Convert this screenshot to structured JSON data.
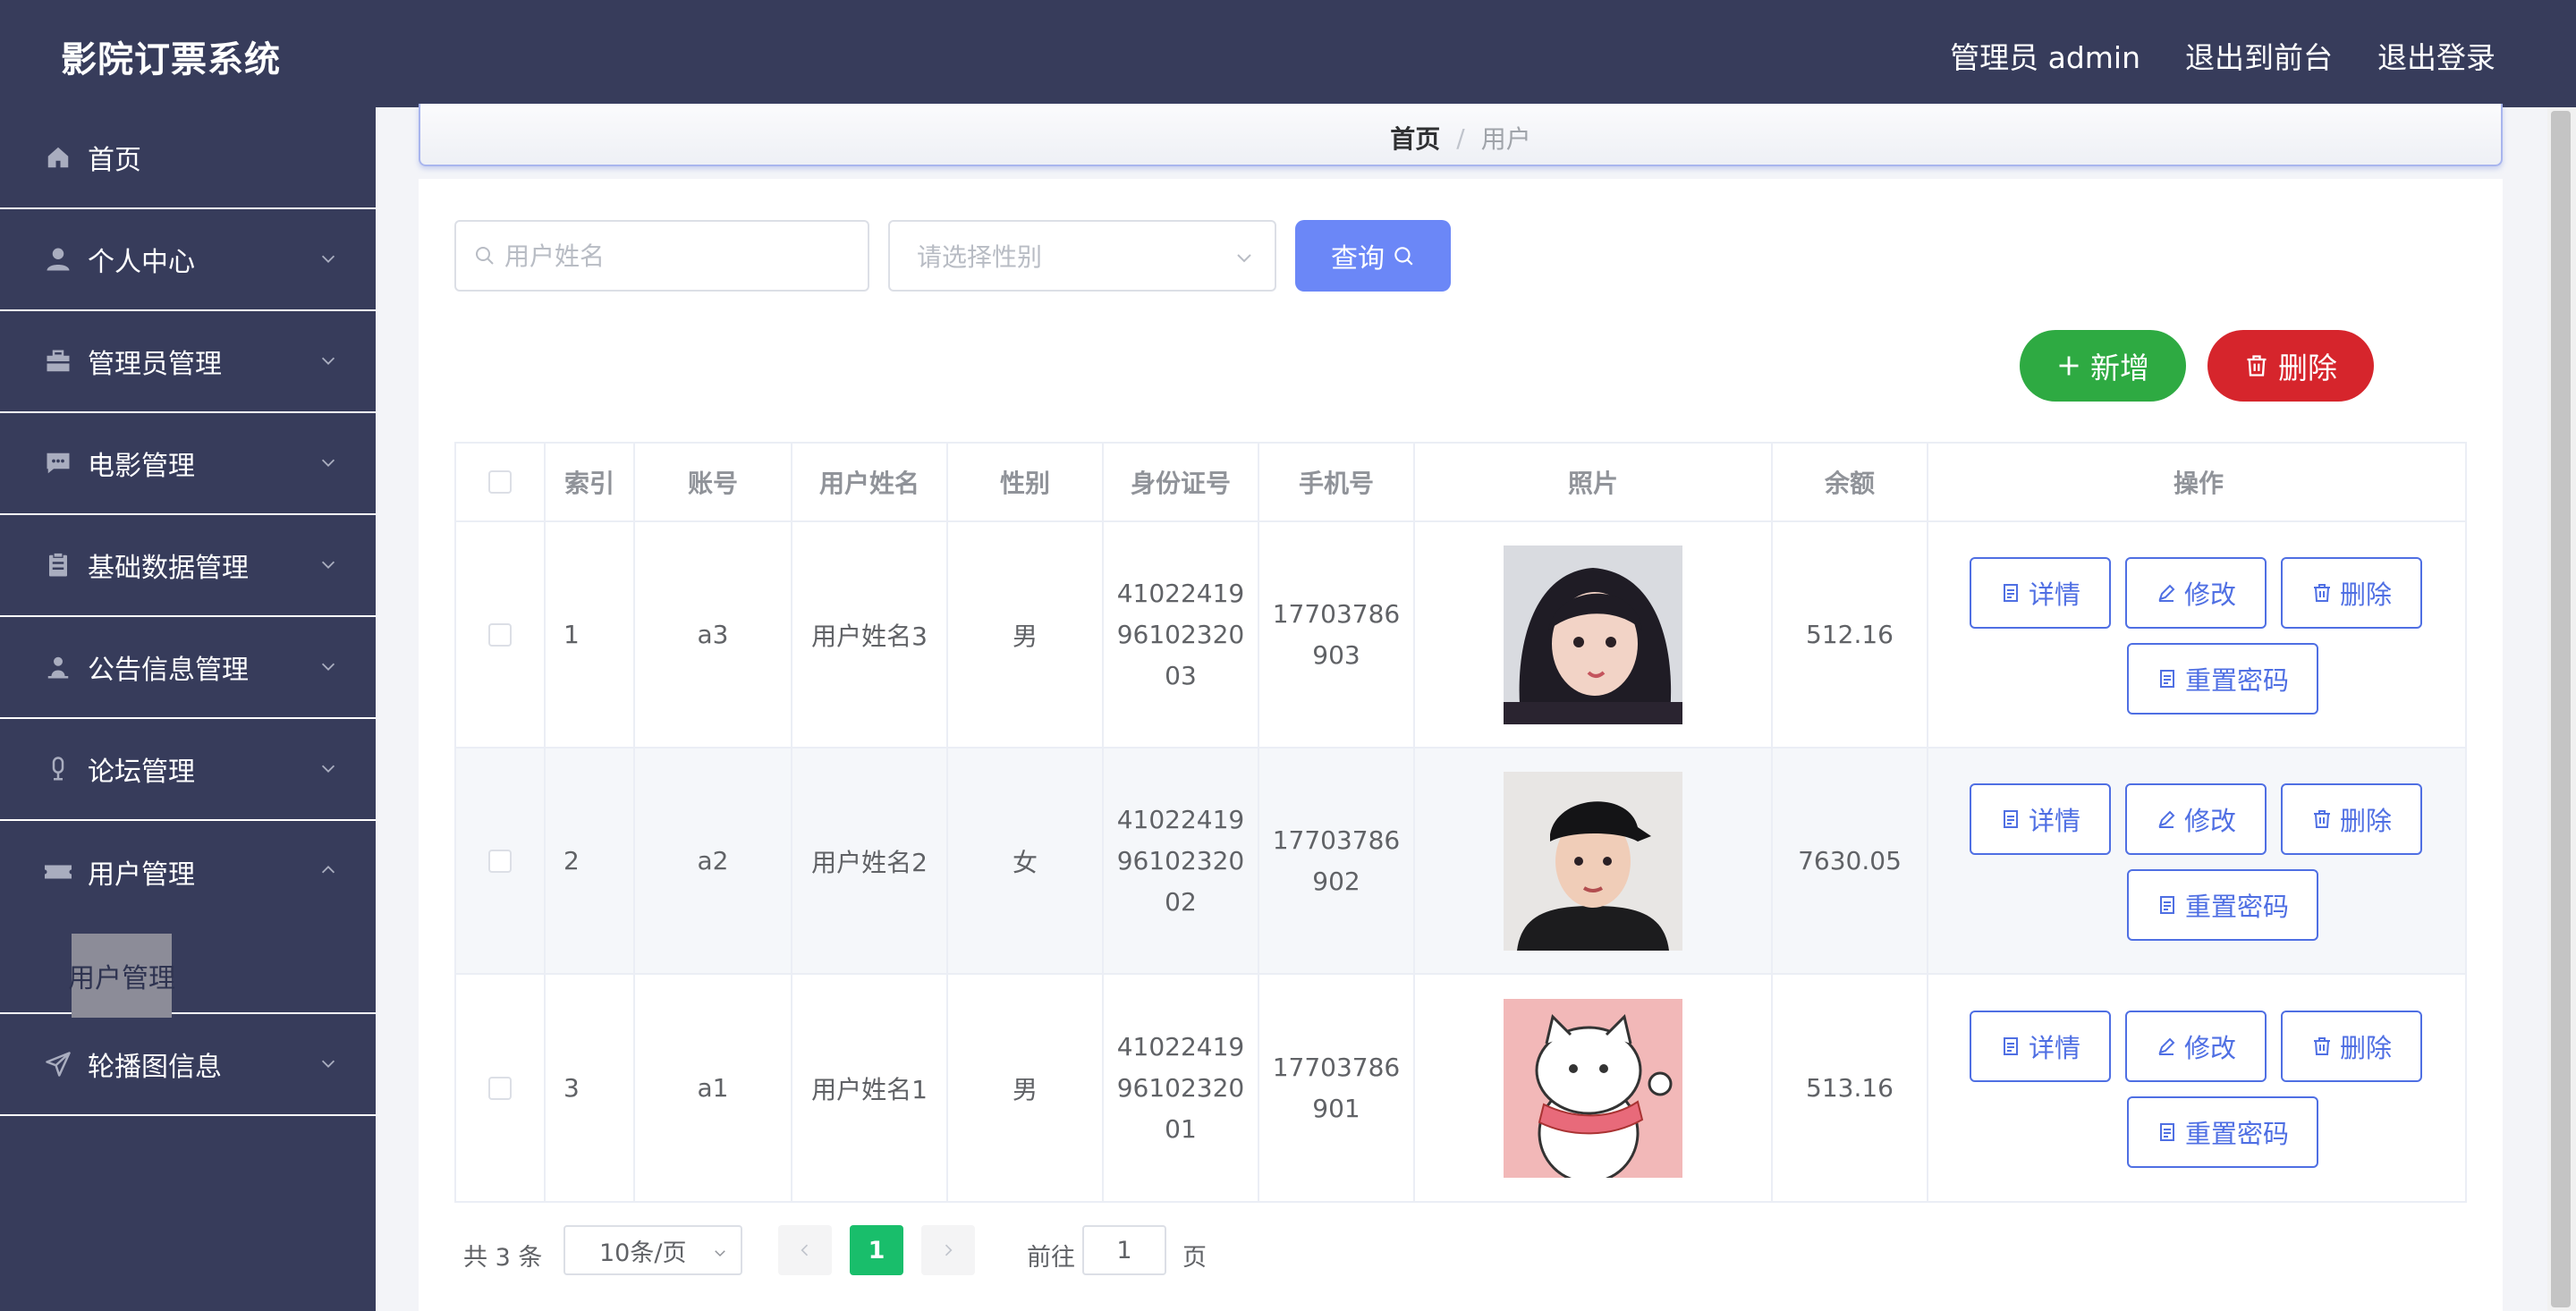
{
  "header": {
    "app_title": "影院订票系统",
    "admin_label": "管理员 admin",
    "to_front_label": "退出到前台",
    "logout_label": "退出登录"
  },
  "sidebar": {
    "items": [
      {
        "label": "首页",
        "icon": "home-icon"
      },
      {
        "label": "个人中心",
        "icon": "user-icon"
      },
      {
        "label": "管理员管理",
        "icon": "briefcase-icon"
      },
      {
        "label": "电影管理",
        "icon": "chat-icon"
      },
      {
        "label": "基础数据管理",
        "icon": "clipboard-icon"
      },
      {
        "label": "公告信息管理",
        "icon": "user-stand-icon"
      },
      {
        "label": "论坛管理",
        "icon": "microphone-icon"
      },
      {
        "label": "用户管理",
        "icon": "ticket-icon",
        "expanded": true
      },
      {
        "label": "轮播图信息",
        "icon": "send-icon"
      }
    ],
    "submenu_label": "用户管理"
  },
  "breadcrumb": {
    "home": "首页",
    "separator": "/",
    "current": "用户"
  },
  "search": {
    "name_placeholder": "用户姓名",
    "gender_placeholder": "请选择性别",
    "query_label": "查询"
  },
  "actions": {
    "add_label": "新增",
    "delete_label": "删除"
  },
  "table": {
    "headers": [
      "索引",
      "账号",
      "用户姓名",
      "性别",
      "身份证号",
      "手机号",
      "照片",
      "余额",
      "操作"
    ],
    "rows": [
      {
        "index": "1",
        "account": "a3",
        "name": "用户姓名3",
        "gender": "男",
        "id_card": "410224199610232003",
        "phone": "17703786903",
        "balance": "512.16"
      },
      {
        "index": "2",
        "account": "a2",
        "name": "用户姓名2",
        "gender": "女",
        "id_card": "410224199610232002",
        "phone": "17703786902",
        "balance": "7630.05"
      },
      {
        "index": "3",
        "account": "a1",
        "name": "用户姓名1",
        "gender": "男",
        "id_card": "410224199610232001",
        "phone": "17703786901",
        "balance": "513.16"
      }
    ],
    "ops": {
      "detail": "详情",
      "edit": "修改",
      "delete": "删除",
      "reset": "重置密码"
    }
  },
  "pagination": {
    "total": "共 3 条",
    "page_size": "10条/页",
    "current_page": "1",
    "goto_label": "前往",
    "goto_value": "1",
    "page_unit": "页"
  },
  "colors": {
    "sidebar_bg": "#373c5b",
    "primary": "#6b87f7",
    "success": "#2eaa42",
    "danger": "#d6252c",
    "page_active": "#19be6b"
  }
}
